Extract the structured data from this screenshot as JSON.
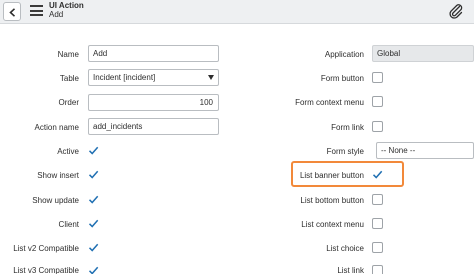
{
  "header": {
    "title": "UI Action",
    "subtitle": "Add"
  },
  "left": {
    "name_label": "Name",
    "name_value": "Add",
    "table_label": "Table",
    "table_value": "Incident [incident]",
    "order_label": "Order",
    "order_value": "100",
    "action_name_label": "Action name",
    "action_name_value": "add_incidents",
    "active_label": "Active",
    "active_checked": true,
    "show_insert_label": "Show insert",
    "show_insert_checked": true,
    "show_update_label": "Show update",
    "show_update_checked": true,
    "client_label": "Client",
    "client_checked": true,
    "list_v2_label": "List v2 Compatible",
    "list_v2_checked": true,
    "list_v3_label": "List v3 Compatible",
    "list_v3_checked": true
  },
  "right": {
    "application_label": "Application",
    "application_value": "Global",
    "form_button_label": "Form button",
    "form_button_checked": false,
    "form_context_menu_label": "Form context menu",
    "form_context_menu_checked": false,
    "form_link_label": "Form link",
    "form_link_checked": false,
    "form_style_label": "Form style",
    "form_style_value": "-- None --",
    "list_banner_button_label": "List banner button",
    "list_banner_button_checked": true,
    "list_bottom_button_label": "List bottom button",
    "list_bottom_button_checked": false,
    "list_context_menu_label": "List context menu",
    "list_context_menu_checked": false,
    "list_choice_label": "List choice",
    "list_choice_checked": false,
    "list_link_label": "List link",
    "list_link_checked": false
  },
  "colors": {
    "check": "#1f6fb2",
    "highlight": "#f2893a",
    "header_bg": "#eef0f2"
  }
}
